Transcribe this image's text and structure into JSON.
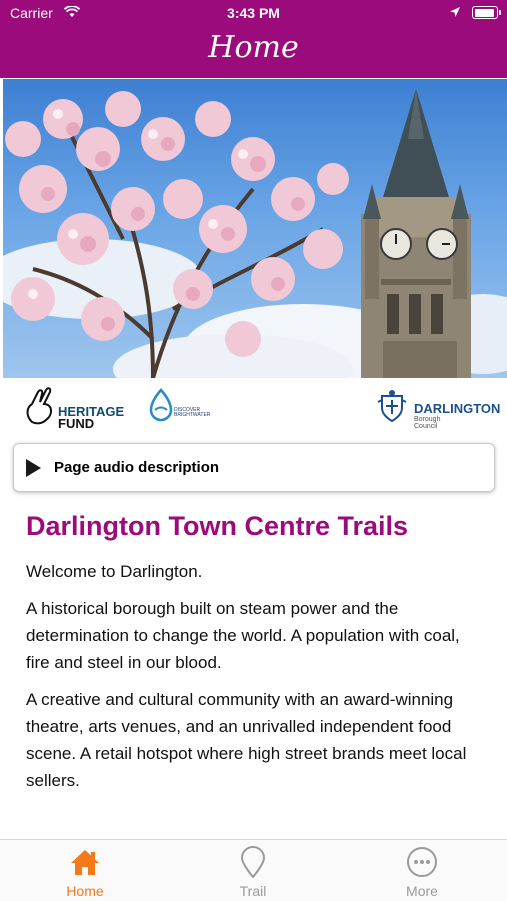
{
  "status_bar": {
    "carrier": "Carrier",
    "time": "3:43 PM"
  },
  "header": {
    "title": "Home"
  },
  "logos": {
    "heritage_line1": "HERITAGE",
    "heritage_line2": "FUND",
    "brightwater_line1": "DISCOVER",
    "brightwater_line2": "BRIGHTWATER",
    "darlington_name": "DARLINGTON",
    "darlington_sub": "Borough Council"
  },
  "audio": {
    "label": "Page audio description"
  },
  "content": {
    "heading": "Darlington Town Centre Trails",
    "paragraphs": [
      "Welcome to Darlington.",
      "A historical borough built on steam power and the determination to change the world. A population with coal, fire and steel in our blood.",
      "A creative and cultural community with an award-winning theatre, arts venues, and an unrivalled independent food scene. A retail hotspot where high street brands meet local sellers."
    ]
  },
  "tabs": [
    {
      "label": "Home",
      "active": true,
      "icon": "home-icon"
    },
    {
      "label": "Trail",
      "active": false,
      "icon": "map-pin-icon"
    },
    {
      "label": "More",
      "active": false,
      "icon": "more-icon"
    }
  ],
  "colors": {
    "brand": "#9c0b7c",
    "active_tab": "#f27a1a",
    "inactive_tab": "#9a9a9a"
  }
}
